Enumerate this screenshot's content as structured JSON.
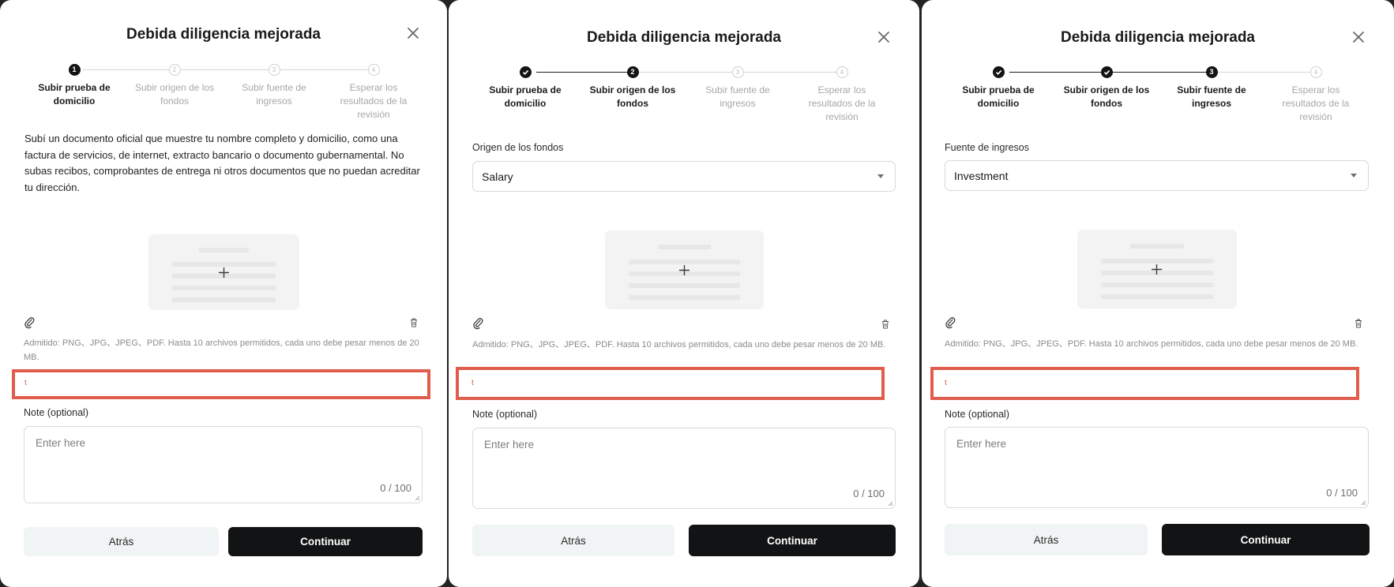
{
  "modal_title": "Debida diligencia mejorada",
  "steps": [
    {
      "label": "Subir prueba de domicilio",
      "number": "1"
    },
    {
      "label": "Subir origen de los fondos",
      "number": "2"
    },
    {
      "label": "Subir fuente de ingresos",
      "number": "3"
    },
    {
      "label": "Esperar los resultados de la revisión",
      "number": "4"
    }
  ],
  "step1": {
    "description": "Subí un documento oficial que muestre tu nombre completo y domicilio, como una factura de servicios, de internet, extracto bancario o documento gubernamental. No subas recibos, comprobantes de entrega ni otros documentos que no puedan acreditar tu dirección."
  },
  "step2": {
    "field_label": "Origen de los fondos",
    "selected_value": "Salary"
  },
  "step3": {
    "field_label": "Fuente de ingresos",
    "selected_value": "Investment"
  },
  "upload_hint": "Admitido: PNG、JPG、JPEG、PDF. Hasta 10 archivos permitidos, cada uno debe pesar menos de 20 MB.",
  "error_text": "t",
  "note": {
    "label": "Note (optional)",
    "placeholder": "Enter here",
    "counter": "0 / 100"
  },
  "buttons": {
    "back": "Atrás",
    "continue": "Continuar"
  },
  "colors": {
    "primary": "#121314",
    "secondary_button": "#f0f4f4",
    "highlight": "#e05d4c"
  }
}
